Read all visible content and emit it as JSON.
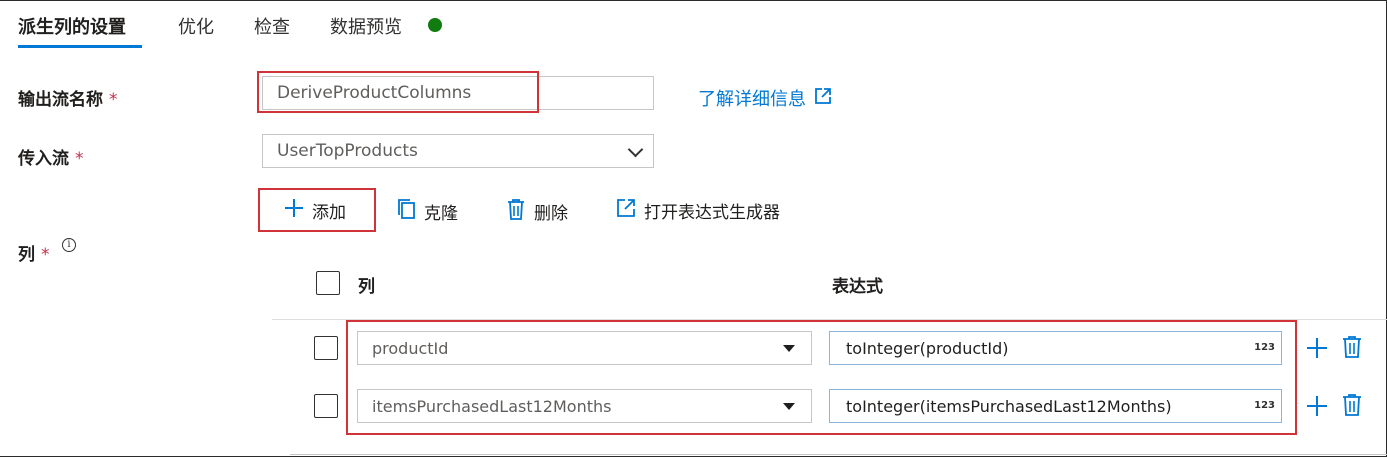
{
  "tabs": [
    {
      "label": "派生列的设置",
      "active": true
    },
    {
      "label": "优化",
      "active": false
    },
    {
      "label": "检查",
      "active": false
    },
    {
      "label": "数据预览",
      "active": false
    }
  ],
  "status_dot_color": "#107c10",
  "form": {
    "output_stream_label": "输出流名称",
    "output_stream_value": "DeriveProductColumns",
    "required_mark": "*",
    "learn_more": "了解详细信息",
    "incoming_stream_label": "传入流",
    "incoming_stream_value": "UserTopProducts",
    "columns_label": "列",
    "info_glyph": "i"
  },
  "toolbar": {
    "add_label": "添加",
    "clone_label": "克隆",
    "delete_label": "删除",
    "open_builder_label": "打开表达式生成器"
  },
  "table": {
    "headers": {
      "column": "列",
      "expression": "表达式"
    },
    "rows": [
      {
        "column": "productId",
        "expression": "toInteger(productId)",
        "type_badge": "123"
      },
      {
        "column": "itemsPurchasedLast12Months",
        "expression": "toInteger(itemsPurchasedLast12Months)",
        "type_badge": "123"
      }
    ]
  },
  "colors": {
    "accent": "#0078d4",
    "highlight_border": "#d13438",
    "required": "#c4314b"
  }
}
